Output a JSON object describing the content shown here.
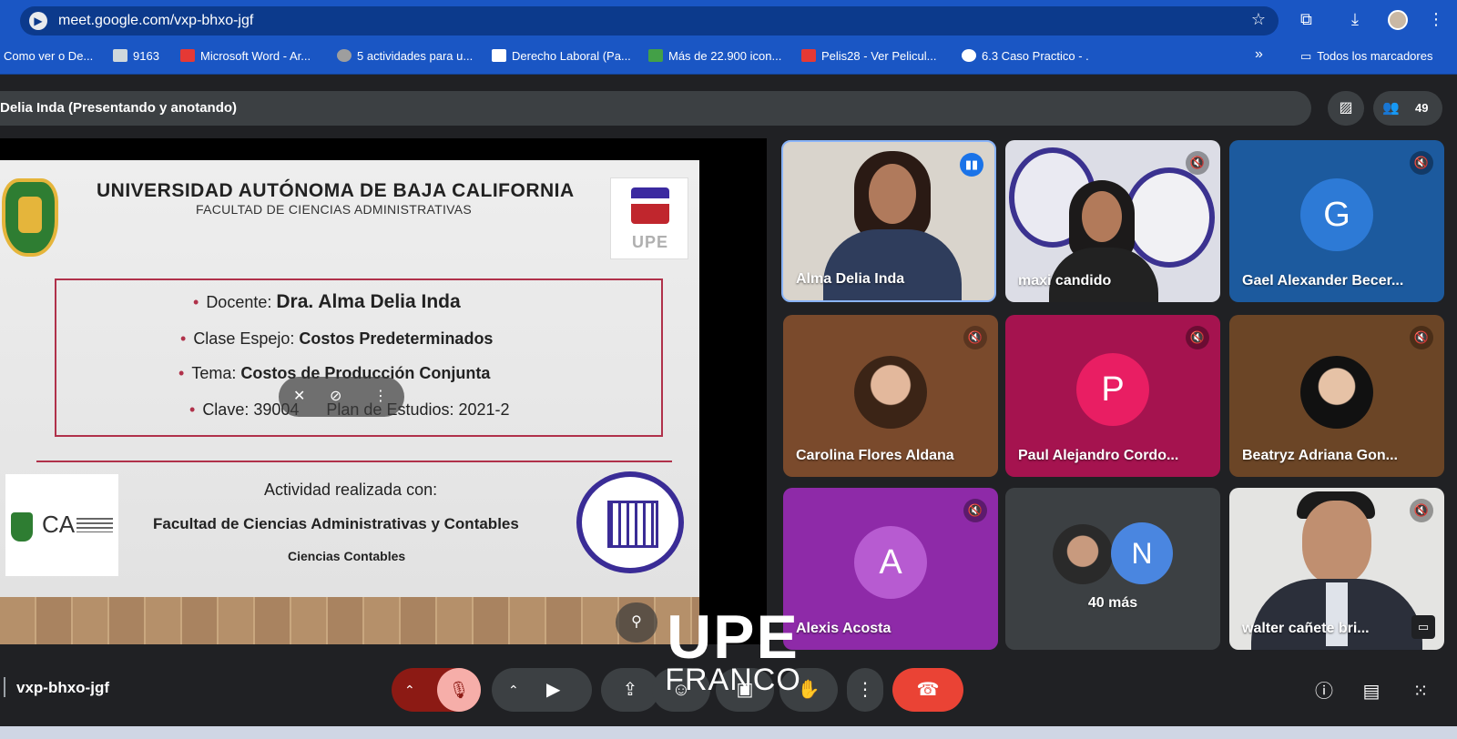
{
  "browser": {
    "url": "meet.google.com/vxp-bhxo-jgf",
    "bookmarks": [
      {
        "label": "Como ver o De...",
        "color": "#ffffff"
      },
      {
        "label": "9163",
        "color": "#cfd8dc"
      },
      {
        "label": "Microsoft Word - Ar...",
        "color": "#e53935"
      },
      {
        "label": "5 actividades para u...",
        "color": "#9e9e9e"
      },
      {
        "label": "Derecho Laboral (Pa...",
        "color": "#ffffff"
      },
      {
        "label": "Más de 22.900 icon...",
        "color": "#43a047"
      },
      {
        "label": "Pelis28 - Ver Pelicul...",
        "color": "#e53935"
      },
      {
        "label": "6.3 Caso Practico - .",
        "color": "#ffffff"
      }
    ],
    "bookmarks_more": "»",
    "all_bookmarks": "Todos los marcadores",
    "icons": [
      "meet-icon",
      "star-icon",
      "extensions-icon",
      "download-icon",
      "profile-icon",
      "menu-icon",
      "folder-icon"
    ]
  },
  "meet": {
    "presenter_banner": "Delia Inda (Presentando y anotando)",
    "participant_count": "49",
    "meeting_code": "vxp-bhxo-jgf",
    "accent_red": "#ea4335"
  },
  "slide": {
    "title": "UNIVERSIDAD AUTÓNOMA DE BAJA CALIFORNIA",
    "subtitle": "FACULTAD DE CIENCIAS ADMINISTRATIVAS",
    "upe_logo_text": "UPE",
    "docente_label": "Docente:",
    "docente_value": "Dra. Alma Delia Inda",
    "clase_label": "Clase Espejo:",
    "clase_value": "Costos Predeterminados",
    "tema_label": "Tema:",
    "tema_value": "Costos de Producción Conjunta",
    "clave_label": "Clave: 39004",
    "plan_label": "Plan de Estudios: 2021-2",
    "actividad": "Actividad realizada con:",
    "facultad": "Facultad de Ciencias Administrativas y Contables",
    "ciencias": "Ciencias Contables",
    "fca_logo_text": "CA"
  },
  "tiles": [
    {
      "name": "Alma Delia Inda",
      "type": "video",
      "bg": "#d9d4cc",
      "speaking": true
    },
    {
      "name": "maxi candido",
      "type": "video",
      "bg": "#dcdde6",
      "muted": true
    },
    {
      "name": "Gael Alexander Becer...",
      "type": "letter",
      "letter": "G",
      "bg": "#1c5a9e",
      "avatar": "#2d7ad6",
      "muted": true
    },
    {
      "name": "Carolina Flores Aldana",
      "type": "photo",
      "bg": "#7a4a2c",
      "muted": true
    },
    {
      "name": "Paul Alejandro Cordo...",
      "type": "letter",
      "letter": "P",
      "bg": "#a5134f",
      "avatar": "#e91e63",
      "muted": true
    },
    {
      "name": "Beatryz Adriana Gon...",
      "type": "photo",
      "bg": "#6b4526",
      "muted": true
    },
    {
      "name": "Alexis Acosta",
      "type": "letter",
      "letter": "A",
      "bg": "#8e2aa8",
      "avatar": "#b75bd1",
      "muted": true
    },
    {
      "name": "40 más",
      "type": "more",
      "letter": "N",
      "bg": "#3c4043",
      "avatar": "#4a86e0"
    },
    {
      "name": "walter cañete bri...",
      "type": "video",
      "bg": "#e4e4e2",
      "muted": true
    }
  ],
  "watermark": {
    "line1": "UPE",
    "line2": "FRANCO"
  }
}
